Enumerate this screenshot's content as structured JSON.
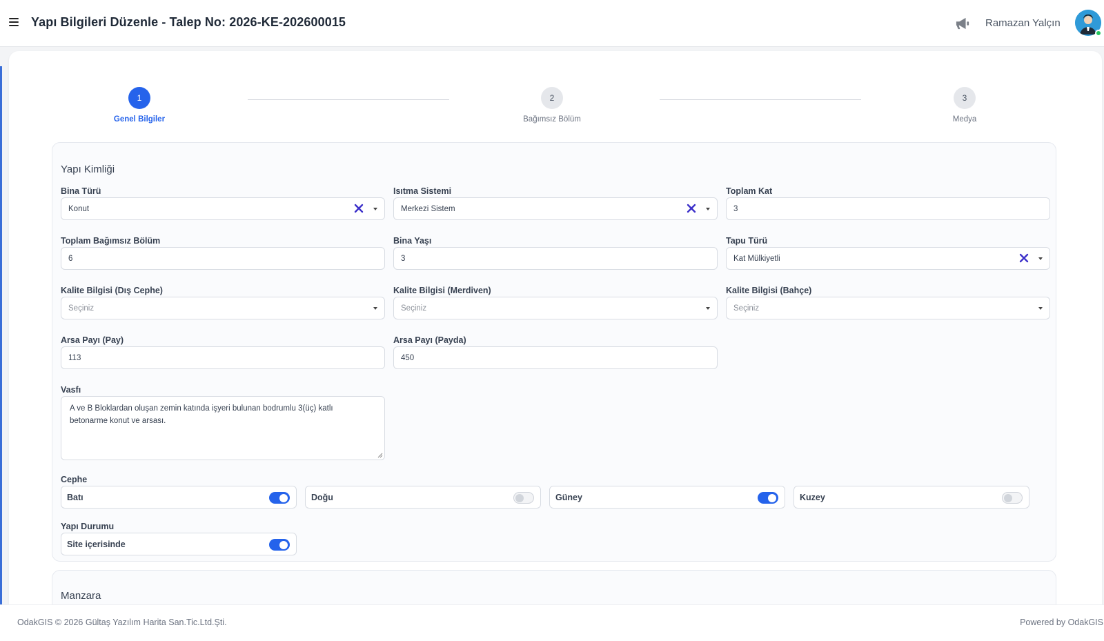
{
  "header": {
    "title": "Yapı Bilgileri Düzenle - Talep No: 2026-KE-202600015",
    "user_name": "Ramazan Yalçın"
  },
  "stepper": {
    "steps": [
      {
        "number": "1",
        "label": "Genel Bilgiler",
        "active": true
      },
      {
        "number": "2",
        "label": "Bağımsız Bölüm",
        "active": false
      },
      {
        "number": "3",
        "label": "Medya",
        "active": false
      }
    ]
  },
  "yapi_kimligi": {
    "title": "Yapı Kimliği",
    "bina_turu": {
      "label": "Bina Türü",
      "value": "Konut"
    },
    "isitma_sistemi": {
      "label": "Isıtma Sistemi",
      "value": "Merkezi Sistem"
    },
    "toplam_kat": {
      "label": "Toplam Kat",
      "value": "3"
    },
    "toplam_bagimsiz_bolum": {
      "label": "Toplam Bağımsız Bölüm",
      "value": "6"
    },
    "bina_yasi": {
      "label": "Bina Yaşı",
      "value": "3"
    },
    "tapu_turu": {
      "label": "Tapu Türü",
      "value": "Kat Mülkiyetli"
    },
    "kalite_dis_cephe": {
      "label": "Kalite Bilgisi (Dış Cephe)",
      "placeholder": "Seçiniz"
    },
    "kalite_merdiven": {
      "label": "Kalite Bilgisi (Merdiven)",
      "placeholder": "Seçiniz"
    },
    "kalite_bahce": {
      "label": "Kalite Bilgisi (Bahçe)",
      "placeholder": "Seçiniz"
    },
    "arsa_payi_pay": {
      "label": "Arsa Payı (Pay)",
      "value": "113"
    },
    "arsa_payi_payda": {
      "label": "Arsa Payı (Payda)",
      "value": "450"
    },
    "vasfi": {
      "label": "Vasfı",
      "line1": "A ve B Bloklardan oluşan zemin katında işyeri bulunan bodrumlu 3(üç) katlı",
      "line2": "betonarme konut ve arsası."
    },
    "cephe": {
      "label": "Cephe",
      "options": [
        {
          "label": "Batı",
          "on": true
        },
        {
          "label": "Doğu",
          "on": false
        },
        {
          "label": "Güney",
          "on": true
        },
        {
          "label": "Kuzey",
          "on": false
        }
      ]
    },
    "yapi_durumu": {
      "label": "Yapı Durumu",
      "options": [
        {
          "label": "Site içerisinde",
          "on": true
        }
      ]
    }
  },
  "manzara": {
    "title": "Manzara"
  },
  "footer": {
    "left": "OdakGIS © 2026 Gültaş Yazılım Harita San.Tic.Ltd.Şti.",
    "right": "Powered by OdakGIS"
  },
  "colors": {
    "accent": "#2563eb",
    "clear_icon": "#3b2fc9",
    "online": "#22c55e"
  }
}
